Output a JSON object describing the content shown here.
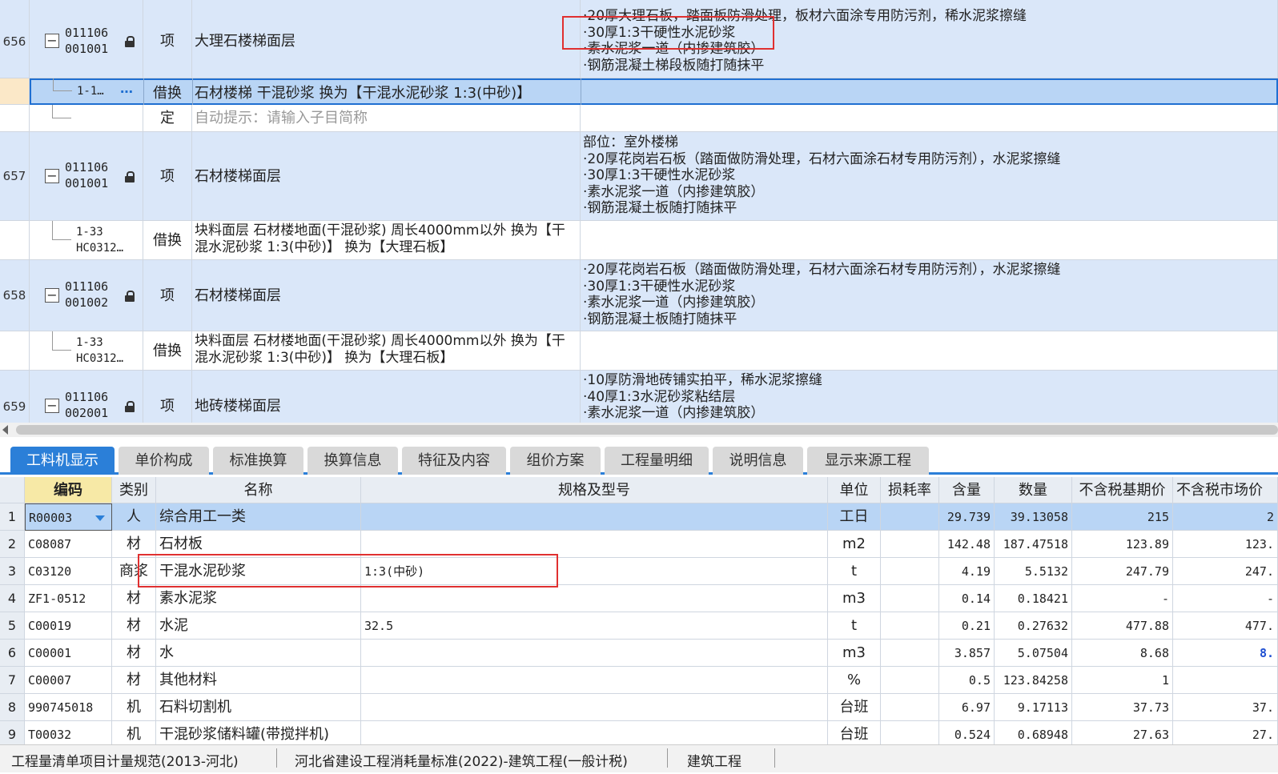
{
  "top_rows": {
    "r656": {
      "no": "656",
      "code1": "011106",
      "code2": "001001",
      "type": "项",
      "name": "大理石楼梯面层",
      "desc": [
        "·20厚大理石板，踏面板防滑处理，板材六面涂专用防污剂，稀水泥浆擦缝",
        "·30厚1:3干硬性水泥砂浆",
        "·素水泥浆一道（内掺建筑胶）",
        "·钢筋混凝土梯段板随打随抹平"
      ]
    },
    "sub1": {
      "code": "1-1…",
      "more": "…",
      "type": "借换",
      "name": "石材楼梯 干混砂浆  换为【干混水泥砂浆 1:3(中砂)】"
    },
    "sub2": {
      "type": "定",
      "name": "自动提示：请输入子目简称"
    },
    "r657": {
      "no": "657",
      "code1": "011106",
      "code2": "001001",
      "type": "项",
      "name": "石材楼梯面层",
      "desc": [
        "部位：室外楼梯",
        "·20厚花岗岩石板（踏面做防滑处理，石材六面涂石材专用防污剂），水泥浆擦缝",
        "·30厚1:3干硬性水泥砂浆",
        "·素水泥浆一道（内掺建筑胶）",
        "·钢筋混凝土板随打随抹平"
      ]
    },
    "sub3": {
      "code1": "1-33",
      "code2": "HC0312…",
      "type": "借换",
      "name1": "块料面层 石材楼地面(干混砂浆) 周长4000mm以外  换为【干",
      "name2": "混水泥砂浆 1:3(中砂)】  换为【大理石板】"
    },
    "r658": {
      "no": "658",
      "code1": "011106",
      "code2": "001002",
      "type": "项",
      "name": "石材楼梯面层",
      "desc": [
        "·20厚花岗岩石板（踏面做防滑处理，石材六面涂石材专用防污剂），水泥浆擦缝",
        "·30厚1:3干硬性水泥砂浆",
        "·素水泥浆一道（内掺建筑胶）",
        "·钢筋混凝土板随打随抹平"
      ]
    },
    "sub4": {
      "code1": "1-33",
      "code2": "HC0312…",
      "type": "借换",
      "name1": "块料面层 石材楼地面(干混砂浆) 周长4000mm以外  换为【干",
      "name2": "混水泥砂浆 1:3(中砂)】  换为【大理石板】"
    },
    "r659": {
      "no": "659",
      "code1": "011106",
      "code2": "002001",
      "type": "项",
      "name": "地砖楼梯面层",
      "desc": [
        "·10厚防滑地砖铺实拍平，稀水泥浆擦缝",
        "·40厚1:3水泥砂浆粘结层",
        "·素水泥浆一道（内掺建筑胶）"
      ]
    }
  },
  "tabs": [
    "工料机显示",
    "单价构成",
    "标准换算",
    "换算信息",
    "特征及内容",
    "组价方案",
    "工程量明细",
    "说明信息",
    "显示来源工程"
  ],
  "grid": {
    "headers": [
      "编码",
      "类别",
      "名称",
      "规格及型号",
      "单位",
      "损耗率",
      "含量",
      "数量",
      "不含税基期价",
      "不含税市场价"
    ],
    "rows": [
      [
        "1",
        "R00003",
        "人",
        "综合用工一类",
        "",
        "工日",
        "",
        "29.739",
        "39.13058",
        "215",
        "2"
      ],
      [
        "2",
        "C08087",
        "材",
        "石材板",
        "",
        "m2",
        "",
        "142.48",
        "187.47518",
        "123.89",
        "123."
      ],
      [
        "3",
        "C03120",
        "商浆",
        "干混水泥砂浆",
        "1:3(中砂)",
        "t",
        "",
        "4.19",
        "5.5132",
        "247.79",
        "247."
      ],
      [
        "4",
        "ZF1-0512",
        "材",
        "素水泥浆",
        "",
        "m3",
        "",
        "0.14",
        "0.18421",
        "-",
        "-"
      ],
      [
        "5",
        "C00019",
        "材",
        "水泥",
        "32.5",
        "t",
        "",
        "0.21",
        "0.27632",
        "477.88",
        "477."
      ],
      [
        "6",
        "C00001",
        "材",
        "水",
        "",
        "m3",
        "",
        "3.857",
        "5.07504",
        "8.68",
        "8."
      ],
      [
        "7",
        "C00007",
        "材",
        "其他材料",
        "",
        "%",
        "",
        "0.5",
        "123.84258",
        "1",
        ""
      ],
      [
        "8",
        "990745018",
        "机",
        "石料切割机",
        "",
        "台班",
        "",
        "6.97",
        "9.17113",
        "37.73",
        "37."
      ],
      [
        "9",
        "T00032",
        "机",
        "干混砂浆储料罐(带搅拌机)",
        "",
        "台班",
        "",
        "0.524",
        "0.68948",
        "27.63",
        "27."
      ]
    ]
  },
  "status": [
    "工程量清单项目计量规范(2013-河北)",
    "河北省建设工程消耗量标准(2022)-建筑工程(一般计税)",
    "建筑工程"
  ],
  "colors": {
    "accent": "#2b7fd8",
    "highlight": "#e03030",
    "row_blue": "#dae7f9"
  }
}
